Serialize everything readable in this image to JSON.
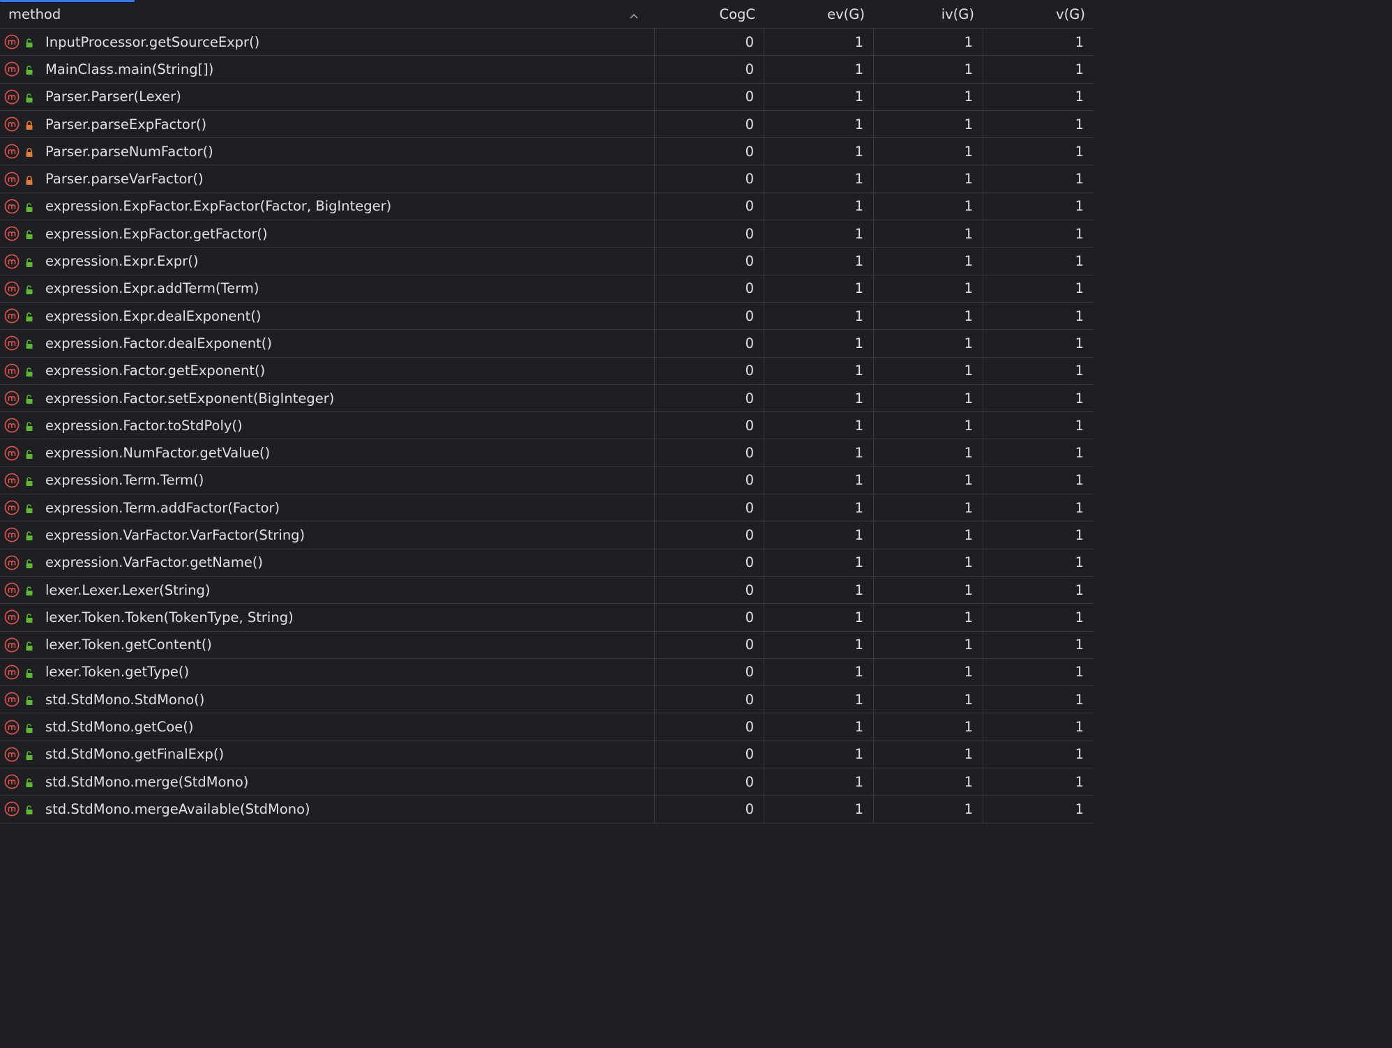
{
  "columns": {
    "method": "method",
    "cogc": "CogC",
    "evg": "ev(G)",
    "ivg": "iv(G)",
    "vg": "v(G)"
  },
  "sort": {
    "column": "method",
    "direction": "ascending",
    "icon": "chevron-up-icon"
  },
  "colors": {
    "method_icon": "#e5534b",
    "public_lock": "#5fb832",
    "private_lock": "#e07b39",
    "accent": "#3574f0"
  },
  "rows": [
    {
      "name": "InputProcessor.getSourceExpr()",
      "access": "public",
      "cogc": "0",
      "evg": "1",
      "ivg": "1",
      "vg": "1"
    },
    {
      "name": "MainClass.main(String[])",
      "access": "public",
      "cogc": "0",
      "evg": "1",
      "ivg": "1",
      "vg": "1"
    },
    {
      "name": "Parser.Parser(Lexer)",
      "access": "public",
      "cogc": "0",
      "evg": "1",
      "ivg": "1",
      "vg": "1"
    },
    {
      "name": "Parser.parseExpFactor()",
      "access": "private",
      "cogc": "0",
      "evg": "1",
      "ivg": "1",
      "vg": "1"
    },
    {
      "name": "Parser.parseNumFactor()",
      "access": "private",
      "cogc": "0",
      "evg": "1",
      "ivg": "1",
      "vg": "1"
    },
    {
      "name": "Parser.parseVarFactor()",
      "access": "private",
      "cogc": "0",
      "evg": "1",
      "ivg": "1",
      "vg": "1"
    },
    {
      "name": "expression.ExpFactor.ExpFactor(Factor, BigInteger)",
      "access": "public",
      "cogc": "0",
      "evg": "1",
      "ivg": "1",
      "vg": "1"
    },
    {
      "name": "expression.ExpFactor.getFactor()",
      "access": "public",
      "cogc": "0",
      "evg": "1",
      "ivg": "1",
      "vg": "1"
    },
    {
      "name": "expression.Expr.Expr()",
      "access": "public",
      "cogc": "0",
      "evg": "1",
      "ivg": "1",
      "vg": "1"
    },
    {
      "name": "expression.Expr.addTerm(Term)",
      "access": "public",
      "cogc": "0",
      "evg": "1",
      "ivg": "1",
      "vg": "1"
    },
    {
      "name": "expression.Expr.dealExponent()",
      "access": "public",
      "cogc": "0",
      "evg": "1",
      "ivg": "1",
      "vg": "1"
    },
    {
      "name": "expression.Factor.dealExponent()",
      "access": "public",
      "cogc": "0",
      "evg": "1",
      "ivg": "1",
      "vg": "1"
    },
    {
      "name": "expression.Factor.getExponent()",
      "access": "public",
      "cogc": "0",
      "evg": "1",
      "ivg": "1",
      "vg": "1"
    },
    {
      "name": "expression.Factor.setExponent(BigInteger)",
      "access": "public",
      "cogc": "0",
      "evg": "1",
      "ivg": "1",
      "vg": "1"
    },
    {
      "name": "expression.Factor.toStdPoly()",
      "access": "public",
      "cogc": "0",
      "evg": "1",
      "ivg": "1",
      "vg": "1"
    },
    {
      "name": "expression.NumFactor.getValue()",
      "access": "public",
      "cogc": "0",
      "evg": "1",
      "ivg": "1",
      "vg": "1"
    },
    {
      "name": "expression.Term.Term()",
      "access": "public",
      "cogc": "0",
      "evg": "1",
      "ivg": "1",
      "vg": "1"
    },
    {
      "name": "expression.Term.addFactor(Factor)",
      "access": "public",
      "cogc": "0",
      "evg": "1",
      "ivg": "1",
      "vg": "1"
    },
    {
      "name": "expression.VarFactor.VarFactor(String)",
      "access": "public",
      "cogc": "0",
      "evg": "1",
      "ivg": "1",
      "vg": "1"
    },
    {
      "name": "expression.VarFactor.getName()",
      "access": "public",
      "cogc": "0",
      "evg": "1",
      "ivg": "1",
      "vg": "1"
    },
    {
      "name": "lexer.Lexer.Lexer(String)",
      "access": "public",
      "cogc": "0",
      "evg": "1",
      "ivg": "1",
      "vg": "1"
    },
    {
      "name": "lexer.Token.Token(TokenType, String)",
      "access": "public",
      "cogc": "0",
      "evg": "1",
      "ivg": "1",
      "vg": "1"
    },
    {
      "name": "lexer.Token.getContent()",
      "access": "public",
      "cogc": "0",
      "evg": "1",
      "ivg": "1",
      "vg": "1"
    },
    {
      "name": "lexer.Token.getType()",
      "access": "public",
      "cogc": "0",
      "evg": "1",
      "ivg": "1",
      "vg": "1"
    },
    {
      "name": "std.StdMono.StdMono()",
      "access": "public",
      "cogc": "0",
      "evg": "1",
      "ivg": "1",
      "vg": "1"
    },
    {
      "name": "std.StdMono.getCoe()",
      "access": "public",
      "cogc": "0",
      "evg": "1",
      "ivg": "1",
      "vg": "1"
    },
    {
      "name": "std.StdMono.getFinalExp()",
      "access": "public",
      "cogc": "0",
      "evg": "1",
      "ivg": "1",
      "vg": "1"
    },
    {
      "name": "std.StdMono.merge(StdMono)",
      "access": "public",
      "cogc": "0",
      "evg": "1",
      "ivg": "1",
      "vg": "1"
    },
    {
      "name": "std.StdMono.mergeAvailable(StdMono)",
      "access": "public",
      "cogc": "0",
      "evg": "1",
      "ivg": "1",
      "vg": "1"
    }
  ]
}
